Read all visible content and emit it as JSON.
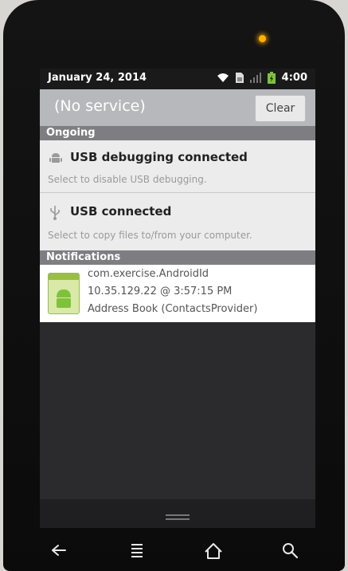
{
  "statusbar": {
    "date": "January 24, 2014",
    "time": "4:00",
    "icons": [
      "wifi-icon",
      "sim-icon",
      "signal-icon",
      "battery-icon"
    ]
  },
  "carrier": {
    "label": "(No service)",
    "clear_label": "Clear"
  },
  "sections": {
    "ongoing": "Ongoing",
    "notifications": "Notifications"
  },
  "ongoing": [
    {
      "icon": "android-debug-icon",
      "title": "USB debugging connected",
      "subtitle": "Select to disable USB debugging."
    },
    {
      "icon": "usb-icon",
      "title": "USB connected",
      "subtitle": "Select to copy files to/from your computer."
    }
  ],
  "notifications": [
    {
      "icon": "android-app-icon",
      "line1": "com.exercise.AndroidId",
      "line2": "10.35.129.22 @ 3:57:15 PM",
      "line3": "Address Book (ContactsProvider)"
    }
  ],
  "nav": [
    "back-icon",
    "menu-icon",
    "home-icon",
    "search-icon"
  ],
  "colors": {
    "led": "#ffb300",
    "battery": "#7ec23a",
    "section_header": "#7e7e82"
  }
}
